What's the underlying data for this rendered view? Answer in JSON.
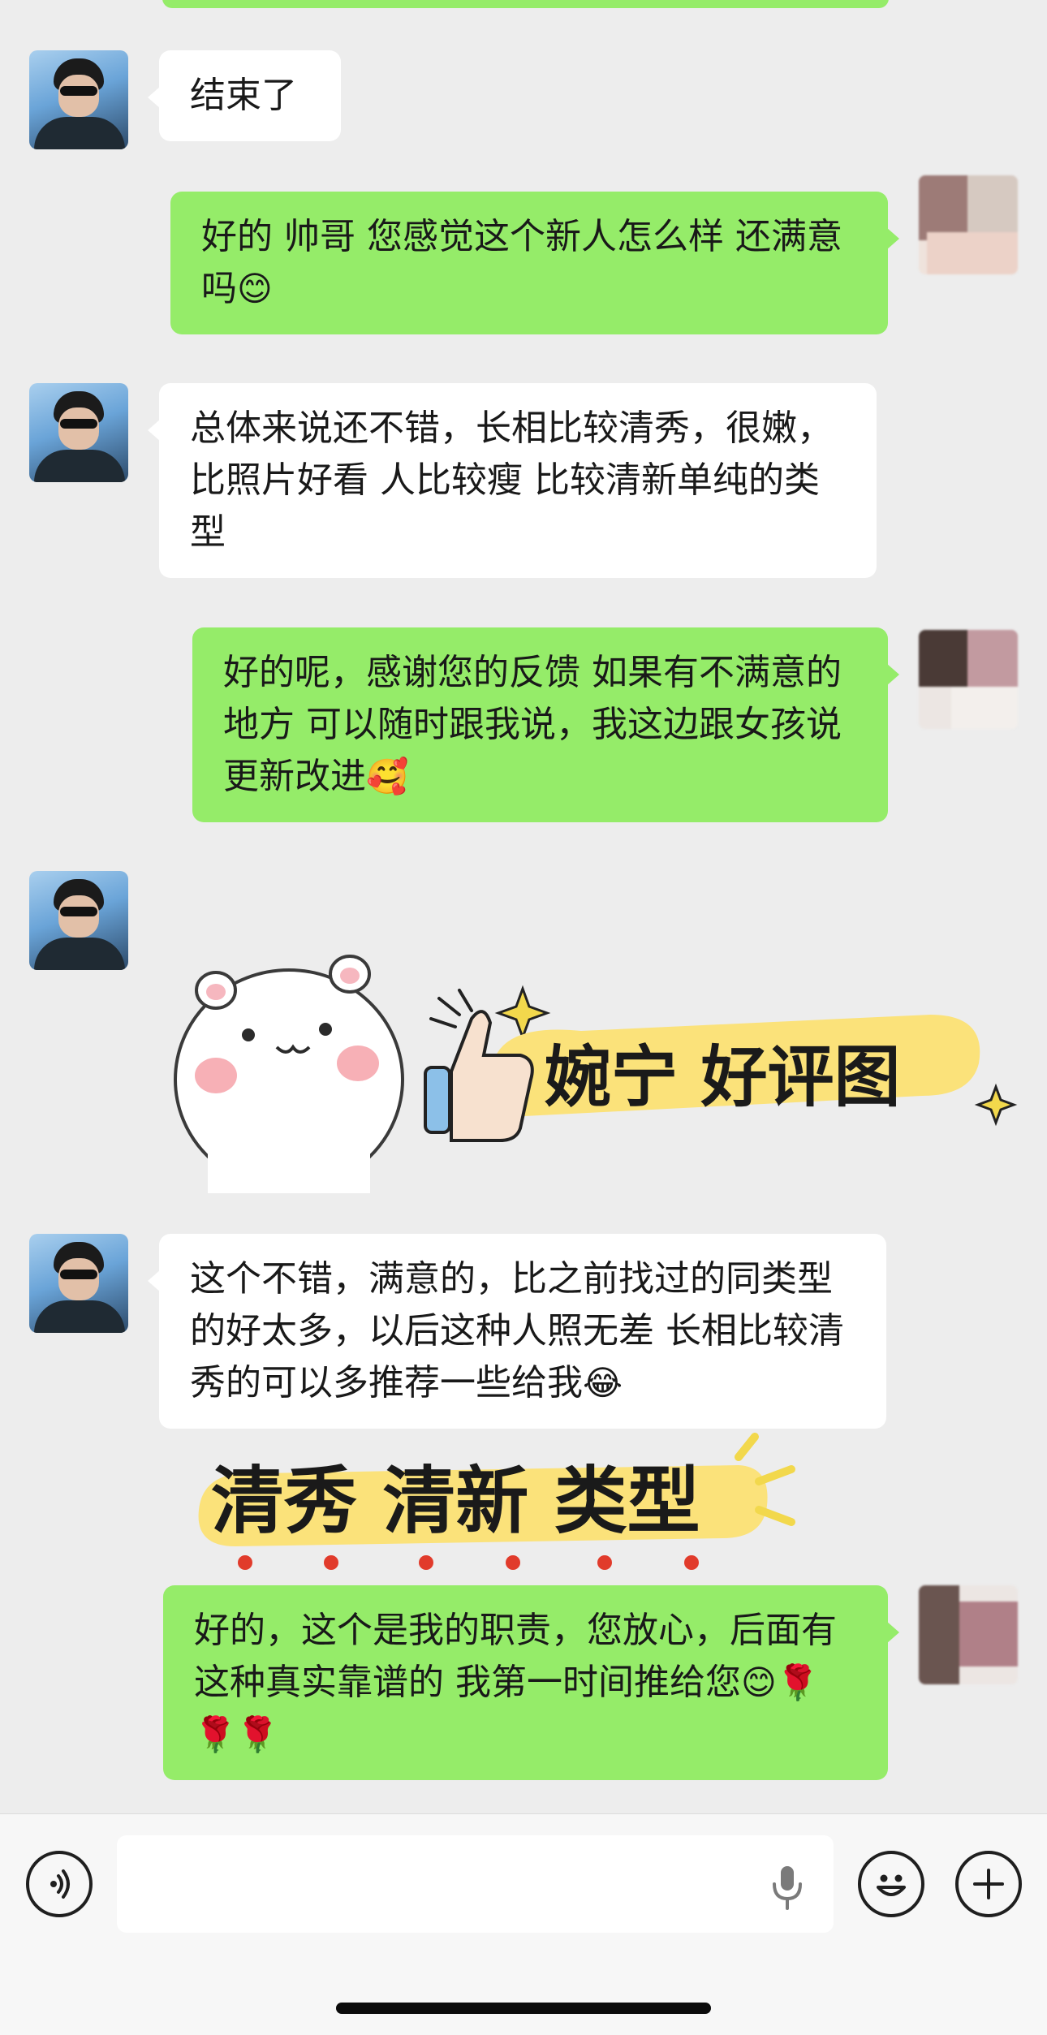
{
  "messages": [
    {
      "side": "in",
      "text": "结束了"
    },
    {
      "side": "out",
      "text": "好的 帅哥 您感觉这个新人怎么样 还满意吗",
      "emoji": "😊"
    },
    {
      "side": "in",
      "text": "总体来说还不错，长相比较清秀，很嫩，比照片好看 人比较瘦 比较清新单纯的类型"
    },
    {
      "side": "out",
      "text": "好的呢，感谢您的反馈 如果有不满意的地方 可以随时跟我说，我这边跟女孩说更新改进",
      "emoji": "🥰"
    },
    {
      "side": "in",
      "type": "sticker",
      "text": "婉宁 好评图"
    },
    {
      "side": "in",
      "text": "这个不错，满意的，比之前找过的同类型的好太多，以后这种人照无差 长相比较清秀的可以多推荐一些给我",
      "emoji": "😂"
    },
    {
      "side": "in",
      "type": "sticker",
      "text": "清秀 清新 类型"
    },
    {
      "side": "out",
      "text": "好的，这个是我的职责，您放心，后面有这种真实靠谱的 我第一时间推给您",
      "emoji": "😊🌹🌹🌹"
    }
  ],
  "input": {
    "value": ""
  },
  "icons": {
    "voice": "voice-toggle-icon",
    "mic": "microphone-icon",
    "emoji": "emoji-icon",
    "plus": "plus-icon"
  },
  "colors": {
    "background": "#ededed",
    "outgoing_bubble": "#95ec69",
    "incoming_bubble": "#ffffff",
    "sticker_highlight": "#fbe27a"
  }
}
